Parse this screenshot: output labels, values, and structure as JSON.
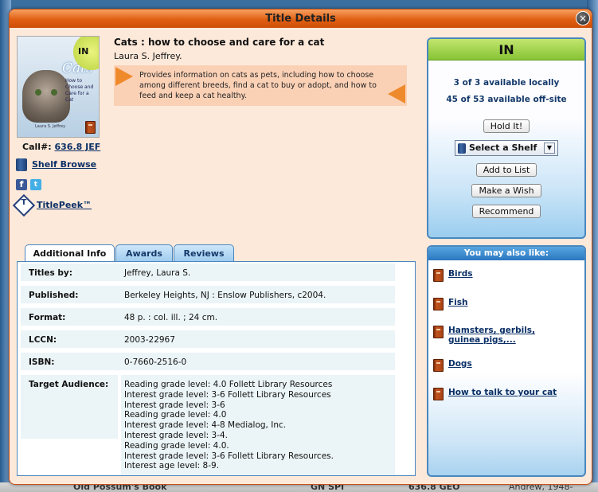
{
  "dialog": {
    "title": "Title Details",
    "close_glyph": "×"
  },
  "book": {
    "title": "Cats : how to choose and care for a cat",
    "author": "Laura S. Jeffrey.",
    "description": "Provides information on cats as pets, including how to choose among different breeds, find a cat to buy or adopt, and how to feed and keep a cat healthy.",
    "cover": {
      "status_badge": "IN",
      "title_text": "Cats",
      "subtitle_text": "How to Choose and Care for a Cat",
      "author_text": "Laura S. Jeffrey"
    }
  },
  "call_number": {
    "label": "Call#:",
    "value": "636.8 JEF"
  },
  "links": {
    "shelf_browse": "Shelf Browse",
    "titlepeek": "TitlePeek™",
    "facebook_glyph": "f",
    "twitter_glyph": "t"
  },
  "availability": {
    "status": "IN",
    "local": "3 of 3 available locally",
    "offsite": "45 of 53 available off-site",
    "hold_button": "Hold It!",
    "select_shelf": "Select a Shelf",
    "add_to_list": "Add to List",
    "make_wish": "Make a Wish",
    "recommend": "Recommend"
  },
  "tabs": [
    {
      "label": "Additional Info",
      "active": true
    },
    {
      "label": "Awards",
      "active": false
    },
    {
      "label": "Reviews",
      "active": false
    }
  ],
  "details": {
    "titles_by": {
      "label": "Titles by:",
      "value": "Jeffrey, Laura S."
    },
    "published": {
      "label": "Published:",
      "value": "Berkeley Heights, NJ : Enslow Publishers, c2004."
    },
    "format": {
      "label": "Format:",
      "value": "48 p. : col. ill. ; 24 cm."
    },
    "lccn": {
      "label": "LCCN:",
      "value": "2003-22967"
    },
    "isbn": {
      "label": "ISBN:",
      "value": "0-7660-2516-0"
    },
    "target_audience": {
      "label": "Target Audience:",
      "lines": [
        "Reading grade level: 4.0 Follett Library Resources",
        "Interest grade level: 3-6 Follett Library Resources",
        "Interest grade level: 3-6",
        "Reading grade level: 4.0",
        "Interest grade level: 4-8 Medialog, Inc.",
        "Interest grade level: 3-4.",
        "Reading grade level: 4.0.",
        "Interest grade level: 3-6 Follett Library Resources.",
        "Interest age level: 8-9."
      ]
    }
  },
  "also_like": {
    "heading": "You may also like:",
    "items": [
      "Birds",
      "Fish",
      "Hamsters, gerbils, guinea pigs,...",
      "Dogs",
      "How to talk to your cat"
    ]
  },
  "background": {
    "item1": "Old Possum's Book",
    "item2": "GN SPI",
    "item3": "636.8 GEO",
    "item4": "Andrew, 1948-"
  }
}
